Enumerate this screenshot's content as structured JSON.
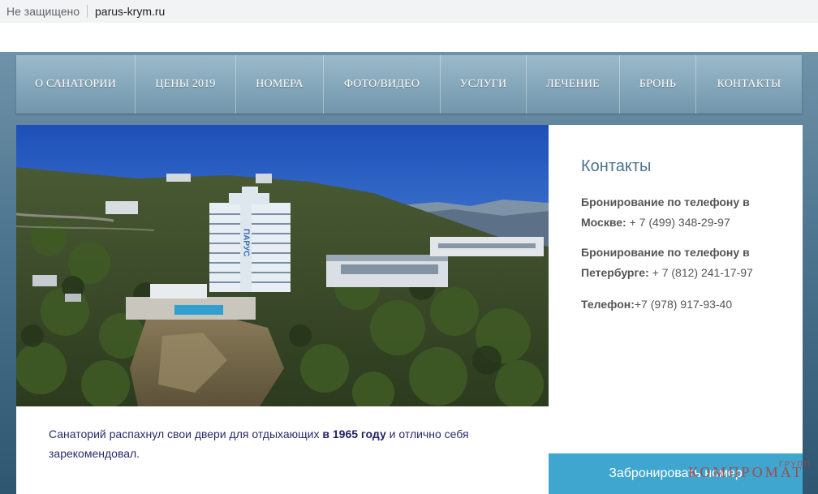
{
  "browser": {
    "security_label": "Не защищено",
    "url": "parus-krym.ru"
  },
  "nav": {
    "items": [
      {
        "label": "О САНАТОРИИ"
      },
      {
        "label": "ЦЕНЫ 2019"
      },
      {
        "label": "НОМЕРА"
      },
      {
        "label": "ФОТО/ВИДЕО"
      },
      {
        "label": "УСЛУГИ"
      },
      {
        "label": "ЛЕЧЕНИЕ"
      },
      {
        "label": "БРОНЬ"
      },
      {
        "label": "КОНТАКТЫ"
      }
    ]
  },
  "hero": {
    "building_sign": "ПАРУС"
  },
  "caption": {
    "text_before": "Санаторий распахнул свои двери для отдыхающих ",
    "text_bold": "в 1965 году",
    "text_after": " и отлично себя зарекомендовал."
  },
  "contacts": {
    "title": "Контакты",
    "moscow_label": "Бронирование по телефону в Москве:",
    "moscow_phone": " + 7 (499) 348-29-97",
    "spb_label": "Бронирование по телефону в Петербурге:",
    "spb_phone": " + 7 (812) 241-17-97",
    "phone_label": "Телефон:",
    "phone_value": "+7 (978) 917-93-40"
  },
  "booking": {
    "button_label": "Забронировать номер"
  },
  "watermark": {
    "main": "КОМПРОМАТ",
    "small": "ГРУПП"
  },
  "colors": {
    "accent_button": "#3fa7cf",
    "contacts_title": "#4a7392",
    "caption_text": "#2a2a6e"
  }
}
